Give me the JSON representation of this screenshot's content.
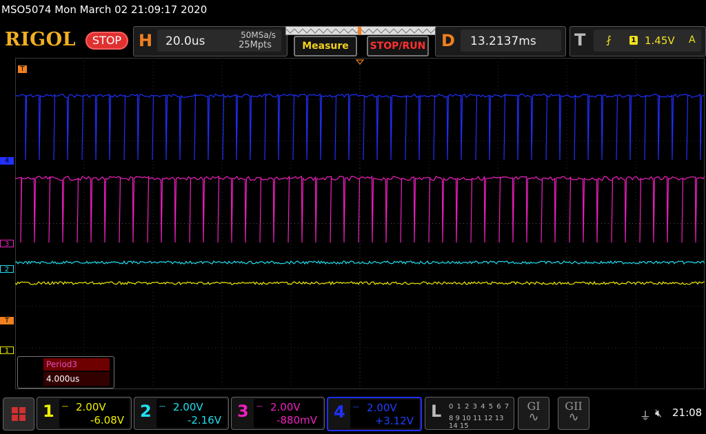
{
  "header": {
    "title": "MSO5074  Mon March 02 21:09:17 2020",
    "brand": "RIGOL",
    "run_state": "STOP"
  },
  "horizontal": {
    "letter": "H",
    "time_scale": "20.0us",
    "sample_rate": "50MSa/s",
    "memory_depth": "25Mpts"
  },
  "buttons": {
    "measure": "Measure",
    "stop_run": "STOP/RUN"
  },
  "delay": {
    "letter": "D",
    "value": "13.2137ms"
  },
  "trigger": {
    "letter": "T",
    "edge_icon": "rising-edge-icon",
    "edge_glyph": "⨏",
    "source": "1",
    "level": "1.45V",
    "mode": "A"
  },
  "markers": {
    "trigger_top": "T",
    "ch4": "4",
    "ch3": "3",
    "ch2": "2",
    "trigger_level": "T",
    "ch1": "1"
  },
  "measurement": {
    "name": "Period3",
    "value": "4.000us"
  },
  "channels": [
    {
      "num": "1",
      "scale": "2.00V",
      "offset": "-6.08V",
      "color": "#f0f000"
    },
    {
      "num": "2",
      "scale": "2.00V",
      "offset": "-2.16V",
      "color": "#20e0f0"
    },
    {
      "num": "3",
      "scale": "2.00V",
      "offset": "-880mV",
      "color": "#f020c0"
    },
    {
      "num": "4",
      "scale": "2.00V",
      "offset": "+3.12V",
      "color": "#2030ff"
    }
  ],
  "logic": {
    "letter": "L",
    "row1": "0 1 2 3  4 5 6 7",
    "row2": "8 9 10 11 12 13 14 15"
  },
  "generators": [
    {
      "label": "GI",
      "icon": "sine-wave-icon"
    },
    {
      "label": "GII",
      "icon": "sine-wave-icon"
    }
  ],
  "status": {
    "usb_icon": "usb-icon",
    "speaker_icon": "speaker-muted-icon",
    "time": "21:08"
  },
  "colors": {
    "ch1": "#f0f000",
    "ch2": "#20e0f0",
    "ch3": "#f020c0",
    "ch4": "#2030ff",
    "accent": "#f08020",
    "stop": "#e03030"
  }
}
